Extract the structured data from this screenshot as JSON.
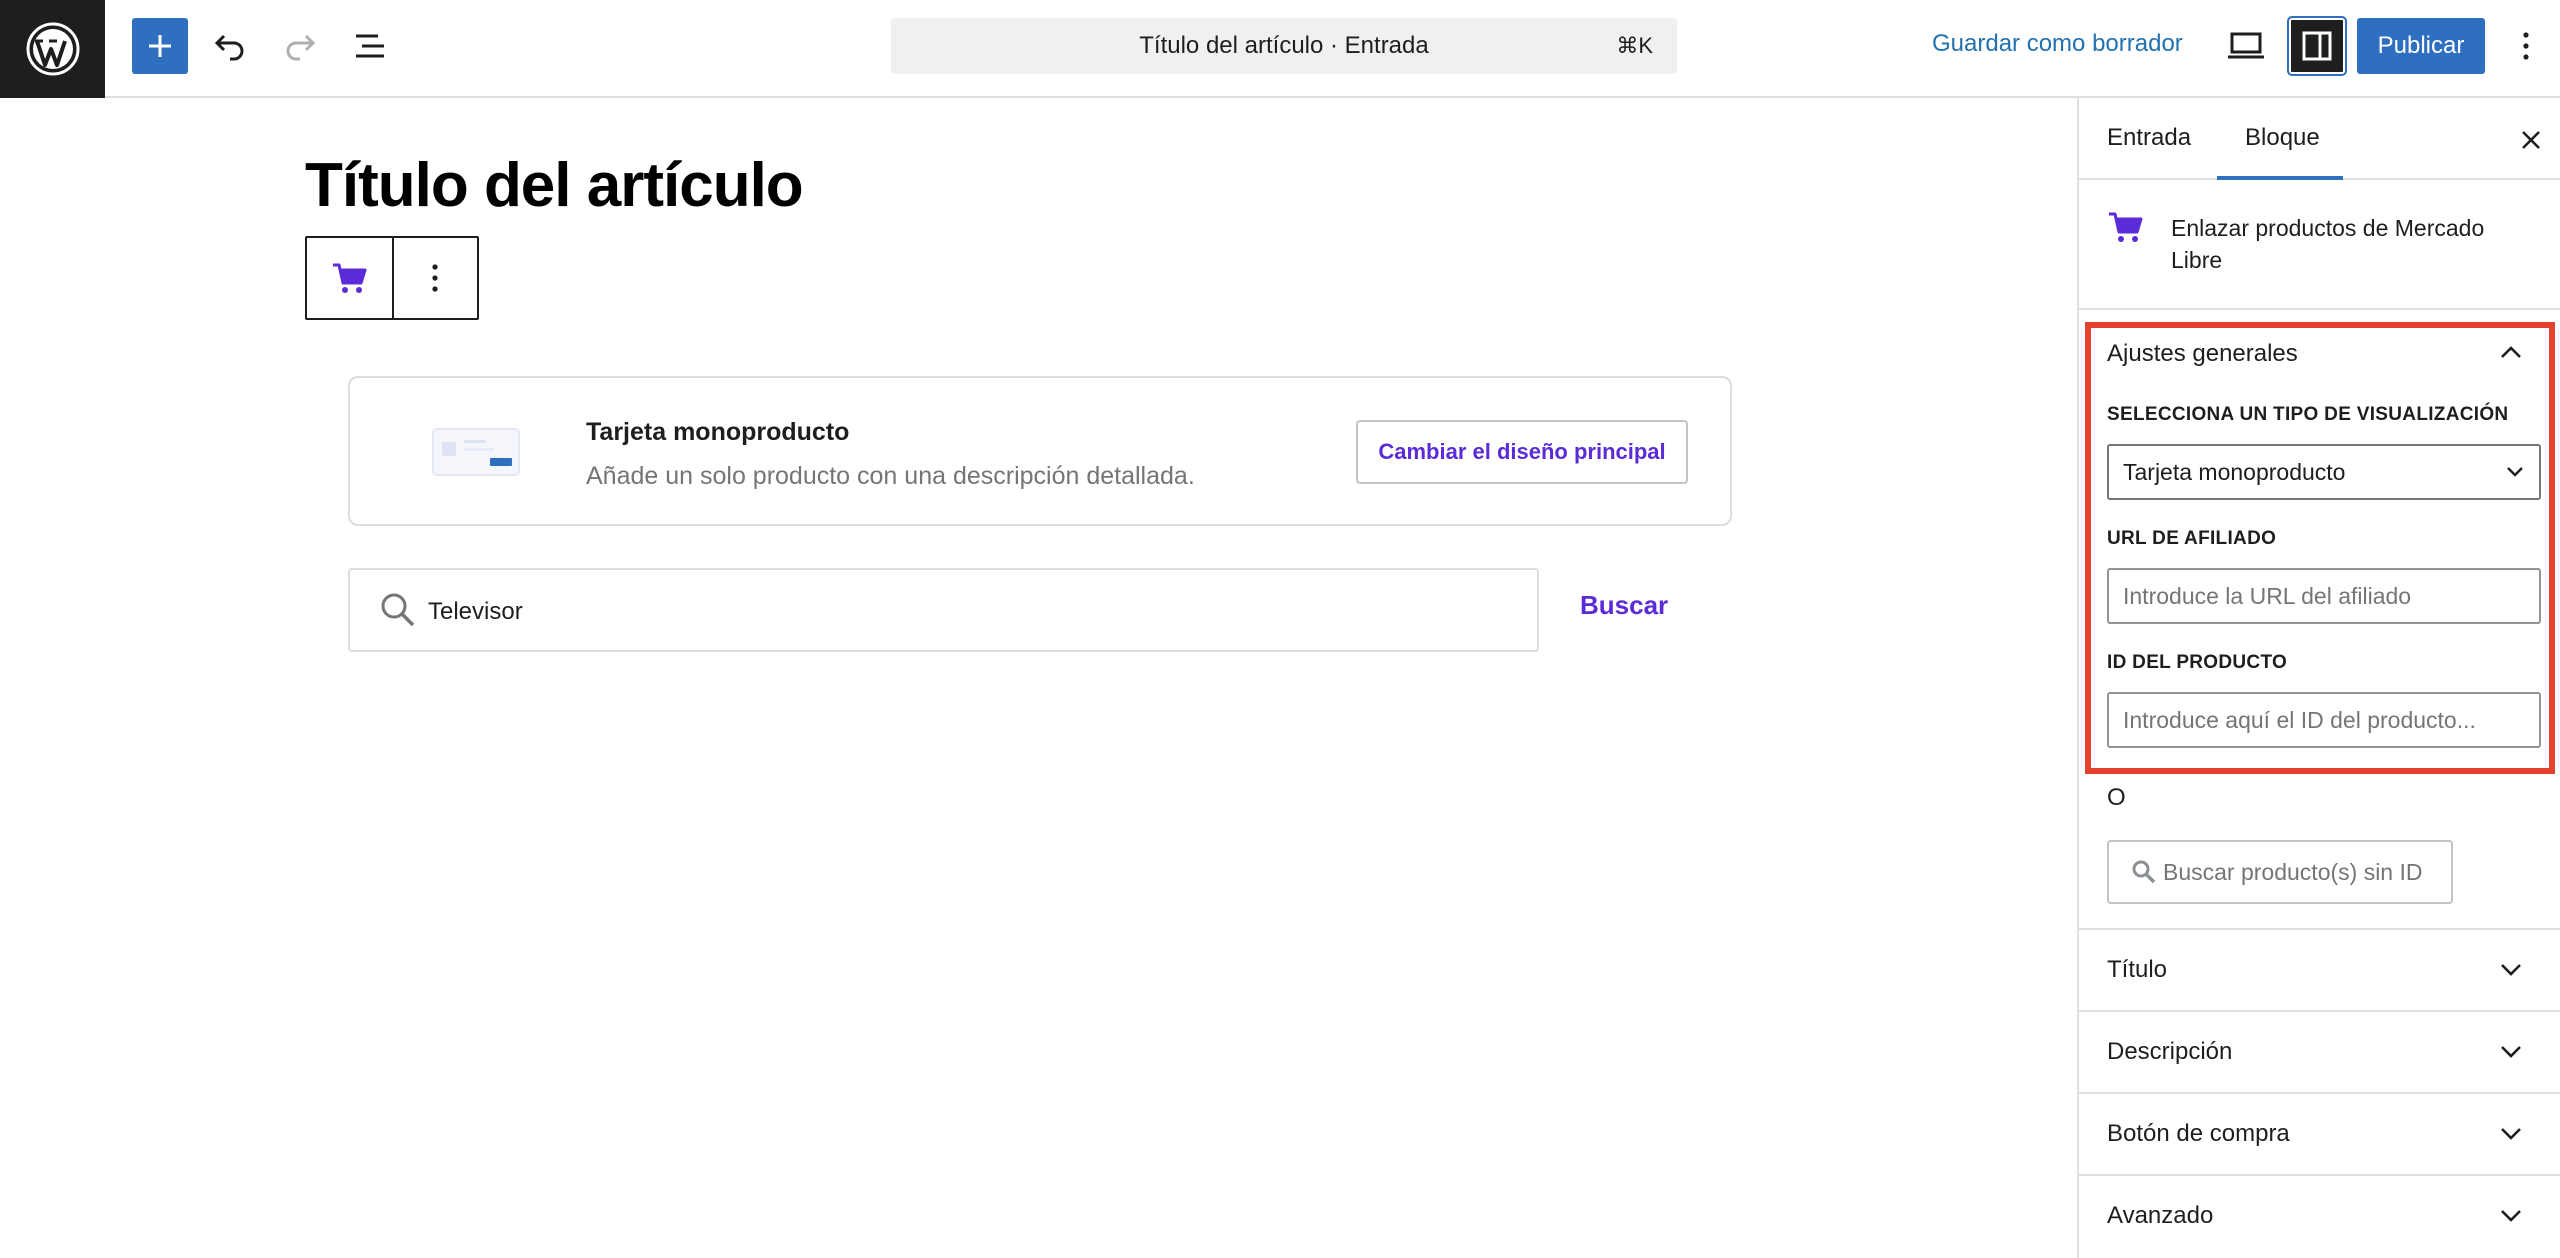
{
  "topbar": {
    "command_bar_title": "Título del artículo · Entrada",
    "command_shortcut": "⌘K",
    "save_draft_label": "Guardar como borrador",
    "publish_label": "Publicar"
  },
  "editor": {
    "post_title": "Título del artículo",
    "card": {
      "title": "Tarjeta monoproducto",
      "description": "Añade un solo producto con una descripción detallada.",
      "change_layout_label": "Cambiar el diseño principal"
    },
    "search": {
      "value": "Televisor",
      "button_label": "Buscar"
    }
  },
  "sidebar": {
    "tabs": [
      {
        "label": "Entrada",
        "active": false
      },
      {
        "label": "Bloque",
        "active": true
      }
    ],
    "block_name": "Enlazar productos de Mercado Libre",
    "general_settings": {
      "title": "Ajustes generales",
      "display_type_label": "SELECCIONA UN TIPO DE VISUALIZACIÓN",
      "display_type_value": "Tarjeta monoproducto",
      "affiliate_url_label": "URL DE AFILIADO",
      "affiliate_url_placeholder": "Introduce la URL del afiliado",
      "product_id_label": "ID DEL PRODUCTO",
      "product_id_placeholder": "Introduce aquí el ID del producto...",
      "or_label": "O",
      "search_no_id_label": "Buscar producto(s) sin ID"
    },
    "collapsed_panels": [
      "Título",
      "Descripción",
      "Botón de compra",
      "Avanzado"
    ]
  },
  "colors": {
    "accent": "#2f6fc0",
    "purple": "#5b2bd8",
    "highlight": "#e5412f"
  }
}
